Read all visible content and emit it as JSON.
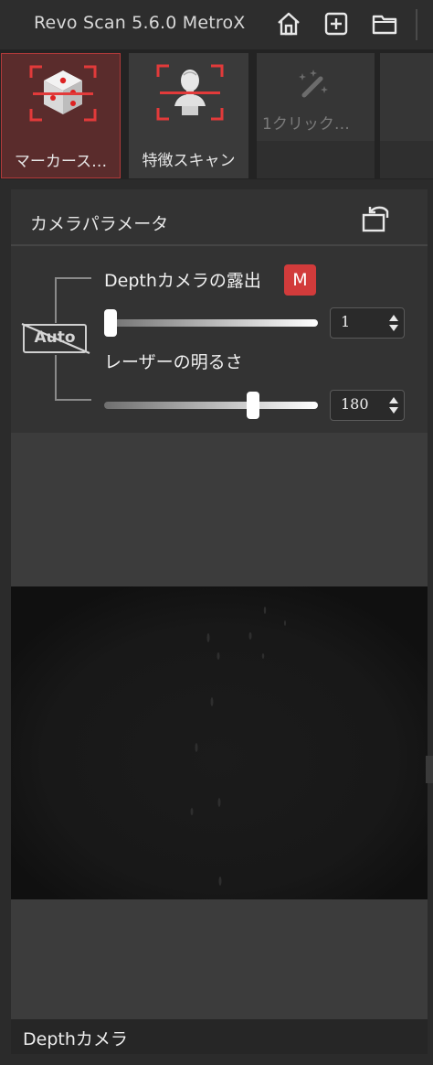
{
  "app": {
    "title": "Revo Scan 5.6.0 MetroX"
  },
  "toolbar": {
    "icons": [
      "home-icon",
      "add-file-icon",
      "folder-icon"
    ]
  },
  "tabs": [
    {
      "label": "マーカース…",
      "icon": "marker-dice-icon",
      "state": "active"
    },
    {
      "label": "特徴スキャン",
      "icon": "bust-scan-icon",
      "state": "normal"
    },
    {
      "label": "1クリック…",
      "icon": "magic-wand-icon",
      "state": "disabled"
    }
  ],
  "camera": {
    "title": "カメラパラメータ",
    "auto_label": "Auto",
    "auto_enabled": false,
    "params": [
      {
        "label": "Depthカメラの露出",
        "badge": "M",
        "value": "1",
        "level": 0.0
      },
      {
        "label": "レーザーの明るさ",
        "value": "180",
        "level": 0.71
      }
    ]
  },
  "preview": {
    "label": "Depthカメラ"
  },
  "colors": {
    "accent": "#d23b3b",
    "active_tab_bg": "#5a2c2c",
    "panel_bg": "#333333",
    "window_bg": "#2b2b2b"
  }
}
